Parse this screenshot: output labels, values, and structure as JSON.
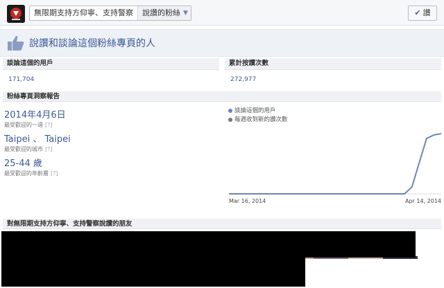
{
  "topbar": {
    "page_name": "無限期支持方仰寧、支持警察",
    "section_label": "說讚的粉絲",
    "liked_label": "讚"
  },
  "header": {
    "title": "說讚和談論這個粉絲專頁的人"
  },
  "stats": {
    "talking_label": "談論這個的用戶",
    "talking_value": "171,704",
    "likes_label": "累計按讚次數",
    "likes_value": "272,977"
  },
  "insights": {
    "heading": "粉絲專頁洞察報告",
    "popular_week_value": "2014年4月6日",
    "popular_week_label": "最受歡迎的一週",
    "popular_city_value": "Taipei 、 Taipei",
    "popular_city_label": "最受歡迎的城市",
    "popular_age_value": "25-44 歲",
    "popular_age_label": "最受歡迎的年齡層",
    "help_mark": "[?]"
  },
  "chart_data": {
    "type": "line",
    "series": [
      {
        "name": "談論這個的用戶",
        "color": "#6d84b4",
        "values": [
          0,
          0,
          0,
          0,
          0,
          0,
          0,
          0,
          0,
          0,
          0,
          0,
          0,
          0,
          0,
          0,
          0,
          0,
          0,
          0,
          0,
          0,
          0,
          0,
          0,
          10,
          45,
          80,
          85,
          87
        ]
      },
      {
        "name": "每週收到新的讚次數",
        "color": "#777777",
        "values": []
      }
    ],
    "x_ticks": [
      "Mar 16, 2014",
      "Apr 14, 2014"
    ]
  },
  "friends": {
    "heading": "對無限期支持方仰寧、支持警察說讚的朋友"
  }
}
